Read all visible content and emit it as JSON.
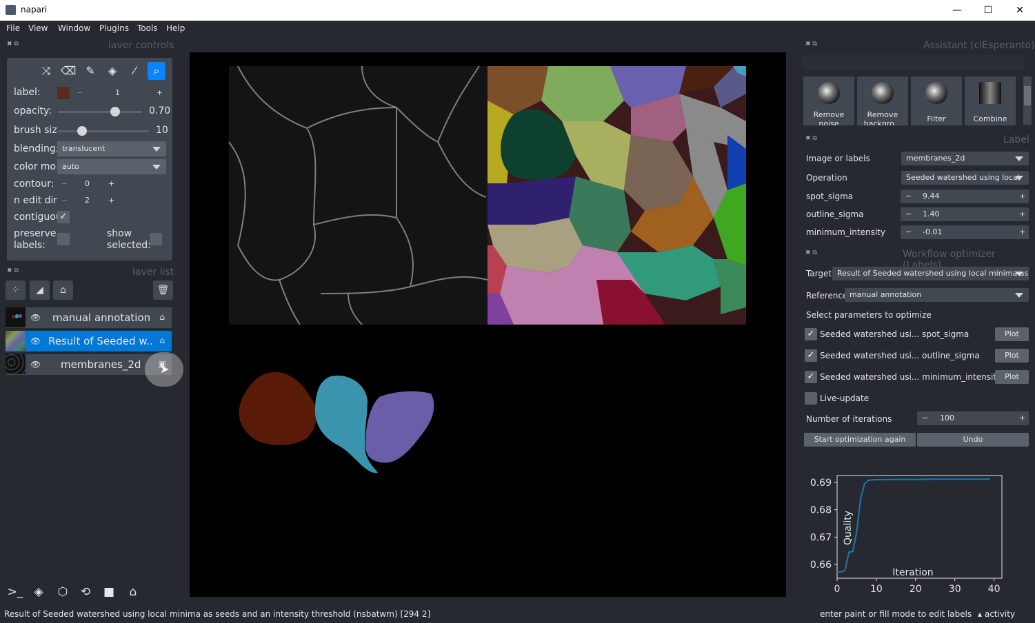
{
  "window": {
    "title": "napari",
    "minimize": "—",
    "maximize": "☐",
    "close": "✕"
  },
  "menu": [
    "File",
    "View",
    "Window",
    "Plugins",
    "Tools",
    "Help"
  ],
  "layer_controls": {
    "title": "laver controls",
    "label": {
      "label": "label:",
      "value": "1",
      "color": "#5a2a1e"
    },
    "opacity": {
      "label": "opacity:",
      "value": "0.70",
      "fraction": 0.7
    },
    "brush_size": {
      "label": "brush siz",
      "value": "10",
      "fraction": 0.25
    },
    "blending": {
      "label": "blending:",
      "value": "translucent"
    },
    "color_mode": {
      "label": "color mo",
      "value": "auto"
    },
    "contour": {
      "label": "contour:",
      "value": "0"
    },
    "n_edit_dim": {
      "label": "n edit din",
      "value": "2"
    },
    "contiguous": {
      "label": "contiguou",
      "checked": true
    },
    "preserve_labels": {
      "label": "preserve labels:",
      "checked": false
    },
    "show_selected": {
      "label": "show selected:",
      "checked": false
    }
  },
  "layer_list": {
    "title": "laver list",
    "layers": [
      {
        "name": "manual annotation",
        "selected": false
      },
      {
        "name": "Result of Seeded w...",
        "selected": true
      },
      {
        "name": "membranes_2d",
        "selected": false
      }
    ]
  },
  "statusbar": {
    "left": "Result of Seeded watershed using local minima as seeds and an intensity threshold (nsbatwm) [294  2]",
    "right": "enter paint or fill mode to edit labels",
    "activity": "activity"
  },
  "assistant": {
    "title": "Assistant (clEsperanto)",
    "tiles": [
      "Remove noise",
      "Remove backgro...",
      "Filter",
      "Combine"
    ]
  },
  "label_panel": {
    "title": "Label",
    "image_or_labels": {
      "label": "Image or labels",
      "value": "membranes_2d"
    },
    "operation": {
      "label": "Operation",
      "value": "Seeded watershed using local"
    },
    "spot_sigma": {
      "label": "spot_sigma",
      "value": "9.44"
    },
    "outline_sigma": {
      "label": "outline_sigma",
      "value": "1.40"
    },
    "minimum_intensity": {
      "label": "minimum_intensity",
      "value": "-0.01"
    }
  },
  "workflow_optimizer": {
    "title": "Workflow optimizer (Labels)",
    "target": {
      "label": "Target",
      "value": "Result of Seeded watershed using local minima as s"
    },
    "reference": {
      "label": "Reference",
      "value": "manual annotation"
    },
    "select_params": "Select parameters to optimize",
    "params": [
      {
        "label": "Seeded watershed usi... spot_sigma",
        "checked": true,
        "button": "Plot"
      },
      {
        "label": "Seeded watershed usi... outline_sigma",
        "checked": true,
        "button": "Plot"
      },
      {
        "label": "Seeded watershed usi... minimum_intensity",
        "checked": true,
        "button": "Plot"
      }
    ],
    "live_update": {
      "label": "Live-update",
      "checked": false
    },
    "iterations": {
      "label": "Number of iterations",
      "value": "100"
    },
    "start_button": "Start optimization again",
    "undo_button": "Undo"
  },
  "chart_data": {
    "type": "line",
    "xlabel": "Iteration",
    "ylabel": "Quality",
    "xlim": [
      0,
      42
    ],
    "ylim": [
      0.655,
      0.6925
    ],
    "xticks": [
      0,
      10,
      20,
      30,
      40
    ],
    "yticks": [
      0.66,
      0.67,
      0.68,
      0.69
    ],
    "ytick_labels": [
      "0.66",
      "0.67",
      "0.68",
      "0.69"
    ],
    "series": [
      {
        "color": "#1f77b4",
        "x": [
          0,
          1,
          2,
          3,
          4,
          5,
          6,
          7,
          8,
          9,
          10,
          12,
          15,
          20,
          25,
          30,
          35,
          39
        ],
        "y": [
          0.6573,
          0.6573,
          0.6578,
          0.6645,
          0.6648,
          0.672,
          0.684,
          0.6895,
          0.6908,
          0.6909,
          0.691,
          0.691,
          0.6911,
          0.6911,
          0.6912,
          0.6912,
          0.6912,
          0.6912
        ]
      }
    ]
  }
}
